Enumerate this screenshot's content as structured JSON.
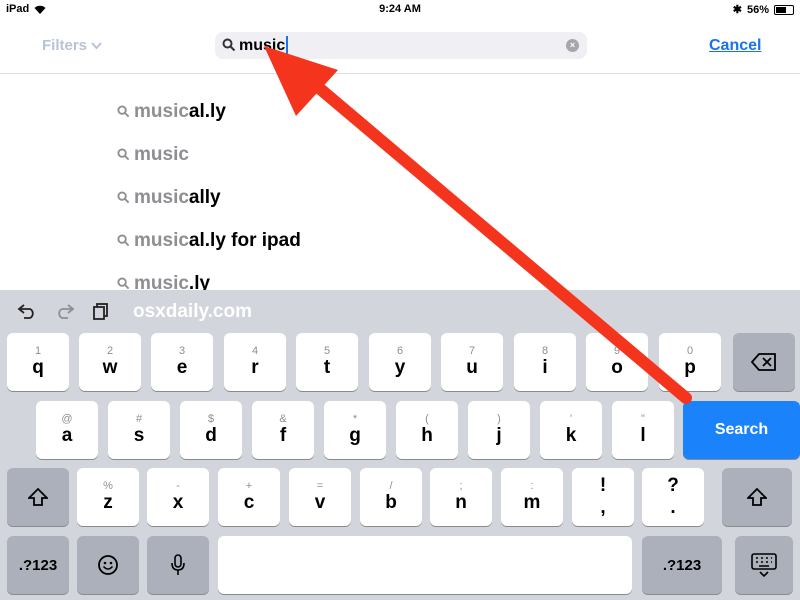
{
  "status_bar": {
    "device": "iPad",
    "time": "9:24 AM",
    "battery": "56%"
  },
  "nav": {
    "filters_label": "Filters",
    "search_value": "music",
    "cancel_label": "Cancel"
  },
  "suggestions": [
    {
      "match": "music",
      "rest": "al.ly"
    },
    {
      "match": "music",
      "rest": ""
    },
    {
      "match": "music",
      "rest": "ally"
    },
    {
      "match": "music",
      "rest": "al.ly for ipad"
    },
    {
      "match": "music",
      "rest": ".ly"
    }
  ],
  "keyboard": {
    "watermark": "osxdaily.com",
    "row1": [
      {
        "sec": "1",
        "pri": "q"
      },
      {
        "sec": "2",
        "pri": "w"
      },
      {
        "sec": "3",
        "pri": "e"
      },
      {
        "sec": "4",
        "pri": "r"
      },
      {
        "sec": "5",
        "pri": "t"
      },
      {
        "sec": "6",
        "pri": "y"
      },
      {
        "sec": "7",
        "pri": "u"
      },
      {
        "sec": "8",
        "pri": "i"
      },
      {
        "sec": "9",
        "pri": "o"
      },
      {
        "sec": "0",
        "pri": "p"
      }
    ],
    "row2": [
      {
        "sec": "@",
        "pri": "a"
      },
      {
        "sec": "#",
        "pri": "s"
      },
      {
        "sec": "$",
        "pri": "d"
      },
      {
        "sec": "&",
        "pri": "f"
      },
      {
        "sec": "*",
        "pri": "g"
      },
      {
        "sec": "(",
        "pri": "h"
      },
      {
        "sec": ")",
        "pri": "j"
      },
      {
        "sec": "'",
        "pri": "k"
      },
      {
        "sec": "\"",
        "pri": "l"
      }
    ],
    "row3": [
      {
        "sec": "%",
        "pri": "z"
      },
      {
        "sec": "-",
        "pri": "x"
      },
      {
        "sec": "+",
        "pri": "c"
      },
      {
        "sec": "=",
        "pri": "v"
      },
      {
        "sec": "/",
        "pri": "b"
      },
      {
        "sec": ";",
        "pri": "n"
      },
      {
        "sec": ":",
        "pri": "m"
      },
      {
        "sec": "!",
        "pri": ","
      },
      {
        "sec": "?",
        "pri": "."
      }
    ],
    "search_label": "Search",
    "numbers_label": ".?123"
  },
  "colors": {
    "accent": "#1a73e8",
    "search_key": "#1a82fb",
    "arrow": "#f5341e"
  }
}
